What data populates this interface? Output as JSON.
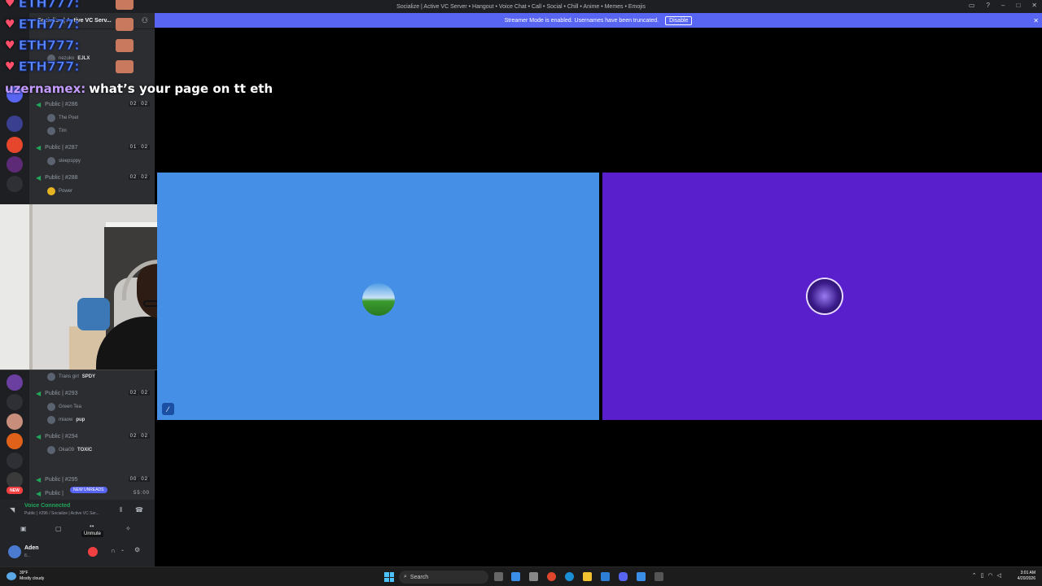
{
  "window": {
    "title": "Socialize | Active VC Server • Hangout • Voice Chat • Call • Social • Chill • Anime • Memes • Emojis"
  },
  "streamer_bar": {
    "message": "Streamer Mode is enabled. Usernames have been truncated.",
    "disable_label": "Disable"
  },
  "server": {
    "name": "Socialize | Active VC Serv..."
  },
  "channels": [
    {
      "name": "Public | #286",
      "count_a": "02",
      "count_b": "02",
      "members": [
        "The Poet",
        "Tim"
      ]
    },
    {
      "name": "Public | #287",
      "count_a": "01",
      "count_b": "02",
      "members": [
        "sleepsppy"
      ]
    },
    {
      "name": "Public | #288",
      "count_a": "02",
      "count_b": "02",
      "members": [
        "Power"
      ]
    },
    {
      "name": "Public | #293",
      "count_a": "02",
      "count_b": "02",
      "members": [
        "Green Tea",
        "miaow"
      ]
    },
    {
      "name": "Public | #294",
      "count_a": "02",
      "count_b": "02",
      "members": [
        "Okai09"
      ]
    },
    {
      "name": "Public | #295",
      "count_a": "00",
      "count_b": "02",
      "members": []
    },
    {
      "name": "Public | ",
      "count_a": "",
      "count_b": "",
      "members": []
    }
  ],
  "extra_members": {
    "trans_girl": "Trans girl",
    "spdy": "SPDY",
    "pup": "pup",
    "toxic": "TOXIC",
    "nezuko": "nezuko",
    "ejlx": "EJLX"
  },
  "stage_timer": "55:00",
  "new_badge": "NEW",
  "new_unreads": "NEW UNREADS",
  "chat_overlay": {
    "repeated_user": "ETH777:",
    "message_user": "uzernamex:",
    "message_text": "what’s your page on tt eth"
  },
  "voice_panel": {
    "status": "Voice Connected",
    "channel": "Public | #296 / Socialize | Active VC Ser...",
    "unmute_tooltip": "Unmute",
    "user_name": "Aden",
    "user_status": "8..."
  },
  "taskbar": {
    "weather_temp": "39°F",
    "weather_desc": "Mostly cloudy",
    "search_label": "Search",
    "time": "3:01 AM",
    "date": "4/20/2026"
  },
  "colors": {
    "blurple": "#5865f2",
    "tile_blue": "#4590e6",
    "tile_purple": "#5a1fcc",
    "voice_green": "#23a55a",
    "danger_red": "#f23f42"
  }
}
